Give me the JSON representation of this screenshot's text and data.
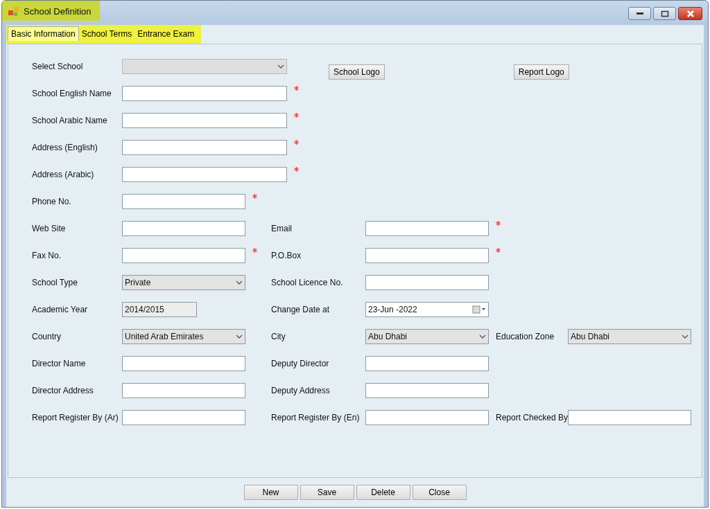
{
  "window": {
    "title": "School Definition",
    "highlighted": true
  },
  "tabs": [
    {
      "label": "Basic Information",
      "selected": true
    },
    {
      "label": "School Terms",
      "selected": false
    },
    {
      "label": "Entrance Exam",
      "selected": false
    }
  ],
  "tabs_highlighted": true,
  "rows": [
    {
      "fields": [
        {
          "label": "Select School",
          "kind": "long_combo",
          "disabled": true
        }
      ],
      "buttons": [
        "School Logo",
        "Report Logo"
      ]
    },
    {
      "fields": [
        {
          "label": "School English Name",
          "kind": "long_text",
          "required": true
        }
      ]
    },
    {
      "fields": [
        {
          "label": "School Arabic Name",
          "kind": "long_text",
          "required": true
        }
      ]
    },
    {
      "fields": [
        {
          "label": "Address (English)",
          "kind": "long_text",
          "required": true
        }
      ]
    },
    {
      "fields": [
        {
          "label": "Address (Arabic)",
          "kind": "long_text",
          "required": true
        }
      ]
    },
    {
      "fields": [
        {
          "label": "Phone No.",
          "kind": "text",
          "required": true
        }
      ]
    },
    {
      "fields": [
        {
          "label": "Web Site",
          "kind": "text"
        },
        {
          "label": "Email",
          "kind": "text",
          "required": true
        }
      ]
    },
    {
      "fields": [
        {
          "label": "Fax No.",
          "kind": "text",
          "required": true
        },
        {
          "label": "P.O.Box",
          "kind": "text",
          "required": true
        }
      ]
    },
    {
      "fields": [
        {
          "label": "School Type",
          "kind": "combo",
          "value": "Private"
        },
        {
          "label": "School Licence No.",
          "kind": "text"
        }
      ]
    },
    {
      "fields": [
        {
          "label": "Academic Year",
          "kind": "readonly",
          "value": "2014/2015"
        },
        {
          "label": "Change Date at",
          "kind": "date",
          "value": "23-Jun -2022"
        }
      ]
    },
    {
      "fields": [
        {
          "label": "Country",
          "kind": "combo",
          "value": "United Arab Emirates"
        },
        {
          "label": "City",
          "kind": "combo",
          "value": "Abu Dhabi"
        },
        {
          "label": "Education Zone",
          "kind": "combo",
          "value": "Abu Dhabi"
        }
      ]
    },
    {
      "fields": [
        {
          "label": "Director Name",
          "kind": "text"
        },
        {
          "label": "Deputy Director",
          "kind": "text"
        }
      ]
    },
    {
      "fields": [
        {
          "label": "Director Address",
          "kind": "text"
        },
        {
          "label": "Deputy Address",
          "kind": "text"
        }
      ]
    },
    {
      "fields": [
        {
          "label": "Report Register By (Ar)",
          "kind": "text"
        },
        {
          "label": "Report Register By (En)",
          "kind": "text"
        },
        {
          "label": "Report Checked By",
          "kind": "text"
        }
      ]
    }
  ],
  "buttons": [
    "New",
    "Save",
    "Delete",
    "Close"
  ]
}
